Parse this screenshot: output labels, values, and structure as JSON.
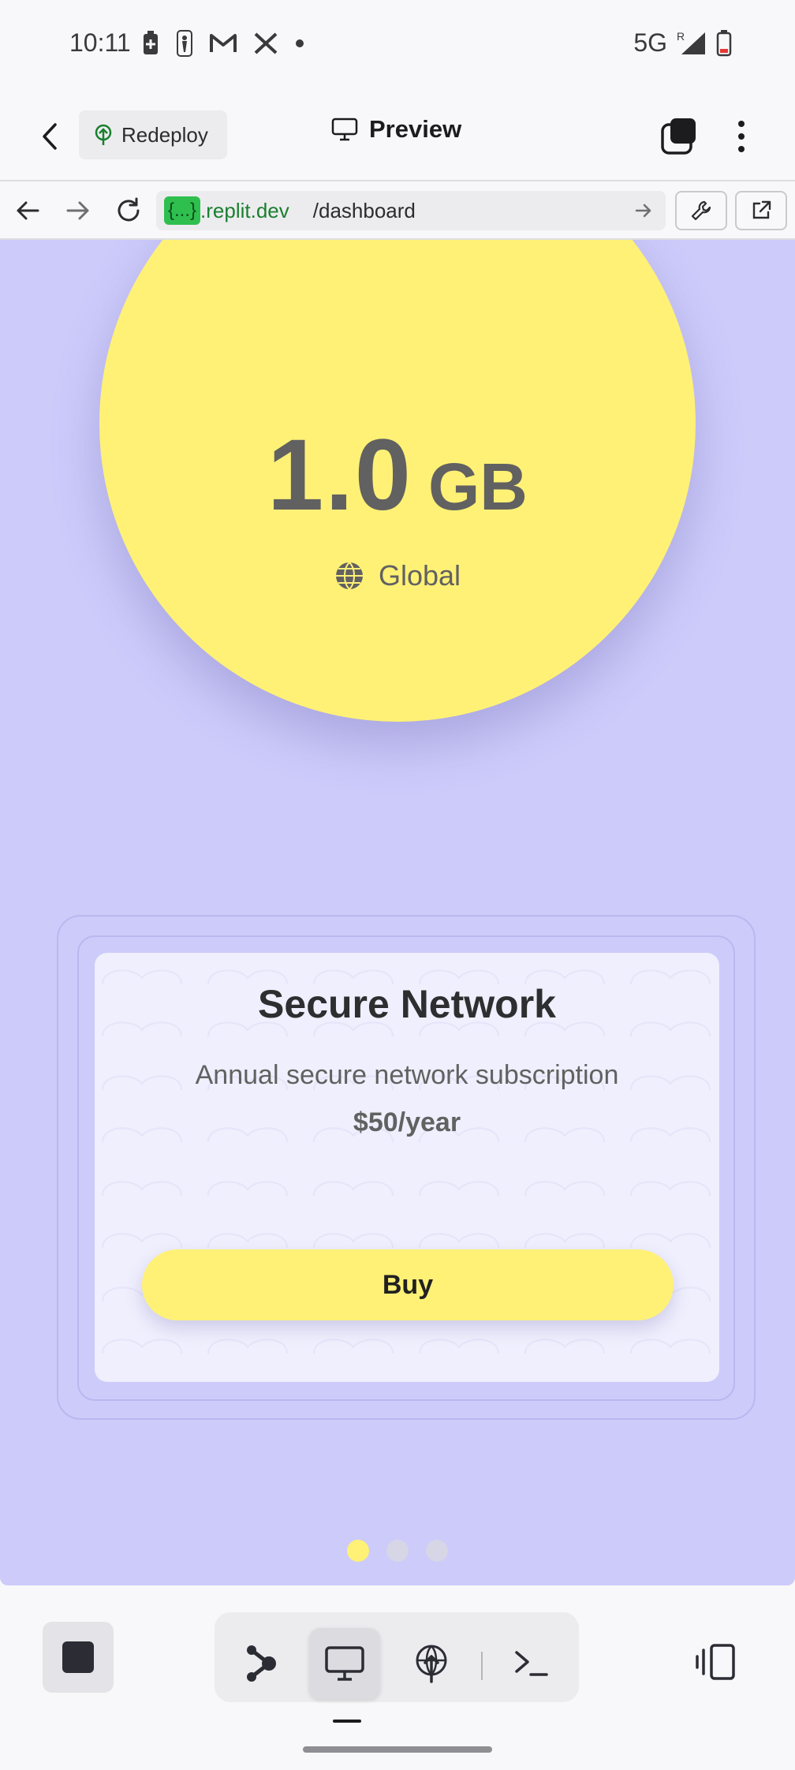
{
  "status_bar": {
    "time": "10:11",
    "network": "5G",
    "roaming": "R",
    "icons": [
      "battery-saver-icon",
      "nba-icon",
      "gmail-icon",
      "x-icon",
      "dot-icon"
    ]
  },
  "toolbar": {
    "redeploy_label": "Redeploy",
    "title": "Preview"
  },
  "browser": {
    "url_badge": "{...}",
    "url_domain": ".replit.dev",
    "url_path": "/dashboard"
  },
  "data_plan": {
    "value": "1.0",
    "unit": "GB",
    "region": "Global"
  },
  "product_card": {
    "title": "Secure Network",
    "description": "Annual secure network subscription",
    "price": "$50/year",
    "buy_label": "Buy"
  },
  "carousel": {
    "page_count": 3,
    "active_index": 0
  },
  "colors": {
    "preview_background": "#cccbfa",
    "accent_yellow": "#fff176",
    "card_background": "#efeffd",
    "url_badge_green": "#2fbf4f"
  }
}
